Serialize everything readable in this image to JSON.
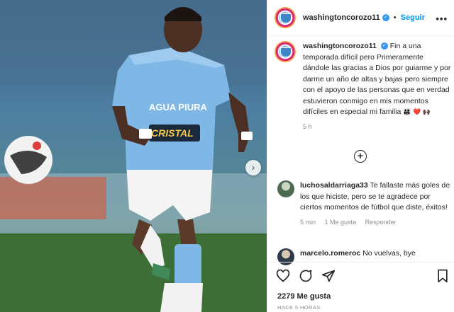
{
  "post": {
    "username": "washingtoncorozo11",
    "follow_label": "Seguir",
    "more_icon": "•••",
    "caption_text": "Fin a una temporada difícil pero Primeramente dándole las gracias a Dios por guiarme y por darme un año de altas y bajas pero siempre con el apoyo de las personas que en verdad estuvieron conmigo en mis momentos difíciles en especial mi familia",
    "caption_emojis": "👨‍👩‍👧 ❤️ 🙌🏿",
    "caption_time": "5 h",
    "likes": "2279 Me gusta",
    "ago": "HACE 5 HORAS"
  },
  "photo": {
    "jersey_sponsor_1": "AGUA PIURA",
    "jersey_sponsor_2": "CRISTAL",
    "next_arrow": "›"
  },
  "comments": [
    {
      "username": "luchosaldarriaga33",
      "text": "Te fallaste más goles de los que hiciste, pero se te agradece por ciertos momentos de fútbol que diste, éxitos!",
      "time": "5 min",
      "likes": "1 Me gusta",
      "reply": "Responder"
    },
    {
      "username": "marcelo.romeroc",
      "text": "No vuelvas, bye"
    }
  ],
  "icons": {
    "verified": "verified-badge",
    "add": "add-circle-icon",
    "like": "heart-icon",
    "comment": "comment-icon",
    "share": "send-icon",
    "save": "bookmark-icon"
  },
  "colors": {
    "follow_blue": "#0095f6",
    "verified_blue": "#3897f0",
    "jersey_blue": "#7fb8e6"
  }
}
